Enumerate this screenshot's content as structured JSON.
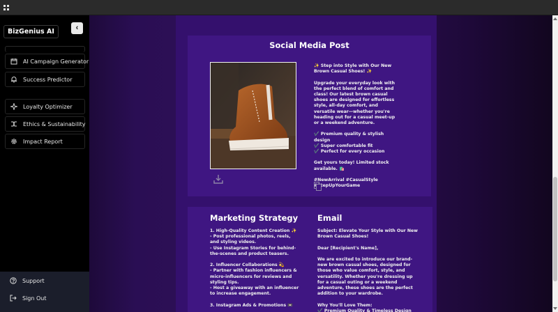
{
  "sidebar": {
    "logo": "BizGenius AI",
    "collapse_glyph": "‹",
    "items": [
      {
        "label": "AI Campaign Generator",
        "icon": "calendar-icon"
      },
      {
        "label": "Success Predictor",
        "icon": "bell-icon"
      },
      {
        "label": "Loyalty Optimizer",
        "icon": "sparkle-icon"
      },
      {
        "label": "Ethics & Sustainability",
        "icon": "shuffle-icon"
      },
      {
        "label": "Impact Report",
        "icon": "gear-icon"
      }
    ],
    "bottom": [
      {
        "label": "Support",
        "icon": "help-icon"
      },
      {
        "label": "Sign Out",
        "icon": "sign-out-icon"
      }
    ]
  },
  "social_post": {
    "title": "Social Media Post",
    "text": "✨ Step into Style with Our New Brown Casual Shoes! ✨\n\nUpgrade your everyday look with the perfect blend of comfort and class! Our latest brown casual shoes are designed for effortless style, all-day comfort, and versatile wear—whether you're heading out for a casual meet-up or a weekend adventure.\n\n✔️ Premium quality & stylish design\n✔️ Super comfortable fit\n✔️ Perfect for every occasion\n\nGet yours today! Limited stock available. 🛍️\n\n#NewArrival #CasualStyle #StepUpYourGame",
    "image_alt": "brown-sneaker-photo"
  },
  "marketing": {
    "title": "Marketing Strategy",
    "text": "1. High-Quality Content Creation ✨\n- Post professional photos, reels, and styling videos.\n- Use Instagram Stories for behind-the-scenes and product teasers.\n\n2. Influencer Collaborations 💫\n- Partner with fashion influencers & micro-influencers for reviews and styling tips.\n- Host a giveaway with an influencer to increase engagement.\n\n3. Instagram Ads & Promotions 📼"
  },
  "email": {
    "title": "Email",
    "text": "Subject: Elevate Your Style with Our New Brown Casual Shoes!\n\nDear [Recipient's Name],\n\nWe are excited to introduce our brand-new brown casual shoes, designed for those who value comfort, style, and versatility. Whether you're dressing up for a casual outing or a weekend adventure, these shoes are the perfect addition to your wardrobe.\n\nWhy You'll Love Them:\n✔️ Premium Quality & Timeless Design"
  },
  "colors": {
    "accent": "#3a157a",
    "sidebar_bg": "#000000",
    "sidebar_bottom_bg": "#1b1e2b"
  }
}
